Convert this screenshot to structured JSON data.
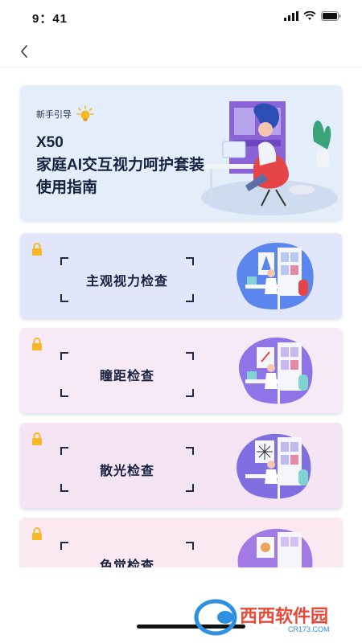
{
  "status_bar": {
    "time": "9：41"
  },
  "guide": {
    "tag": "新手引导",
    "title_lines": [
      "X50",
      "家庭AI交互视力呵护套装",
      "使用指南"
    ]
  },
  "checks": [
    {
      "label": "主观视力检查",
      "bg": "#e2e6fb",
      "blob": "#5b86ee"
    },
    {
      "label": "瞳距检查",
      "bg": "#f8e9f6",
      "blob": "#8e74e6"
    },
    {
      "label": "散光检查",
      "bg": "#f5e4f4",
      "blob": "#7f6fe0"
    },
    {
      "label": "色觉检查",
      "bg": "#fbe9f1",
      "blob": "#a17ae6"
    }
  ],
  "watermark": {
    "brand": "西西软件园",
    "url": "CR173.COM"
  },
  "colors": {
    "lock": "#f5b928",
    "title": "#16213f"
  },
  "icons": {
    "back": "chevron-left-icon",
    "lock": "lock-icon",
    "bulb": "lightbulb-icon"
  }
}
